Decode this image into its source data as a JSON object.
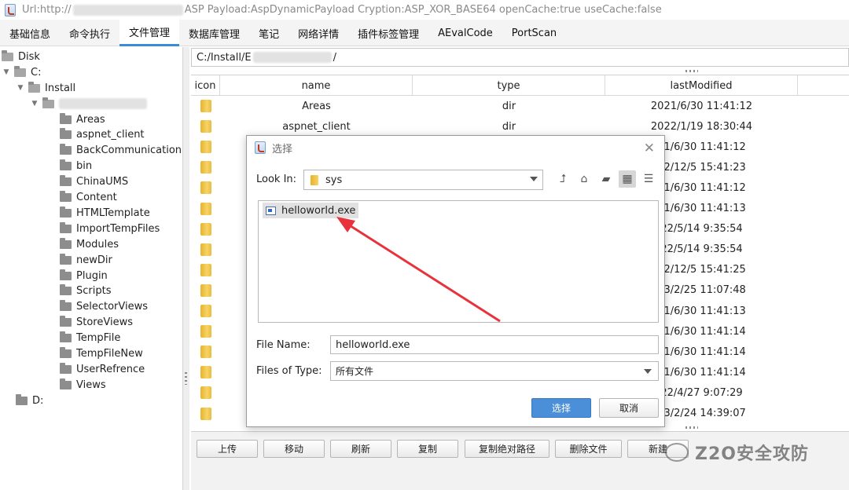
{
  "window": {
    "title_prefix": "Url:http://",
    "title_suffix": "ASP Payload:AspDynamicPayload Cryption:ASP_XOR_BASE64 openCache:true useCache:false"
  },
  "menu": [
    "基础信息",
    "命令执行",
    "文件管理",
    "数据库管理",
    "笔记",
    "网络详情",
    "插件标签管理",
    "AEvalCode",
    "PortScan"
  ],
  "menu_active": "文件管理",
  "tree": {
    "disk_label": "Disk",
    "c_label": "C:",
    "install_label": "Install",
    "d_label": "D:",
    "children": [
      "Areas",
      "aspnet_client",
      "BackCommunication",
      "bin",
      "ChinaUMS",
      "Content",
      "HTMLTemplate",
      "ImportTempFiles",
      "Modules",
      "newDir",
      "Plugin",
      "Scripts",
      "SelectorViews",
      "StoreViews",
      "TempFile",
      "TempFileNew",
      "UserRefrence",
      "Views"
    ]
  },
  "path": {
    "prefix": "C:/Install/E",
    "suffix": "/"
  },
  "table": {
    "headers": {
      "icon": "icon",
      "name": "name",
      "type": "type",
      "modified": "lastModified"
    },
    "rows": [
      {
        "name": "Areas",
        "type": "dir",
        "modified": "2021/6/30 11:41:12"
      },
      {
        "name": "aspnet_client",
        "type": "dir",
        "modified": "2022/1/19 18:30:44"
      },
      {
        "name": "",
        "type": "",
        "modified": "21/6/30 11:41:12"
      },
      {
        "name": "",
        "type": "",
        "modified": "22/12/5 15:41:23"
      },
      {
        "name": "",
        "type": "",
        "modified": "21/6/30 11:41:12"
      },
      {
        "name": "",
        "type": "",
        "modified": "21/6/30 11:41:13"
      },
      {
        "name": "",
        "type": "",
        "modified": "22/5/14 9:35:54"
      },
      {
        "name": "",
        "type": "",
        "modified": "22/5/14 9:35:54"
      },
      {
        "name": "",
        "type": "",
        "modified": "22/12/5 15:41:25"
      },
      {
        "name": "",
        "type": "",
        "modified": "23/2/25 11:07:48"
      },
      {
        "name": "",
        "type": "",
        "modified": "21/6/30 11:41:13"
      },
      {
        "name": "",
        "type": "",
        "modified": "21/6/30 11:41:14"
      },
      {
        "name": "",
        "type": "",
        "modified": "21/6/30 11:41:14"
      },
      {
        "name": "",
        "type": "",
        "modified": "21/6/30 11:41:14"
      },
      {
        "name": "",
        "type": "",
        "modified": "22/4/27 9:07:29"
      },
      {
        "name": "",
        "type": "",
        "modified": "23/2/24 14:39:07"
      }
    ]
  },
  "actions": [
    "上传",
    "移动",
    "刷新",
    "复制",
    "复制绝对路径",
    "删除文件",
    "新建"
  ],
  "dialog": {
    "title": "选择",
    "look_in_label": "Look In:",
    "look_in_value": "sys",
    "files": [
      "helloworld.exe"
    ],
    "file_name_label": "File Name:",
    "file_name_value": "helloworld.exe",
    "files_of_type_label": "Files of Type:",
    "files_of_type_value": "所有文件",
    "ok_label": "选择",
    "cancel_label": "取消"
  },
  "watermark": "Z2O安全攻防",
  "colors": {
    "accent": "#3c8ad8",
    "ok_button": "#4a8fd8",
    "arrow": "#e8323c",
    "folder": "#f0c040"
  }
}
